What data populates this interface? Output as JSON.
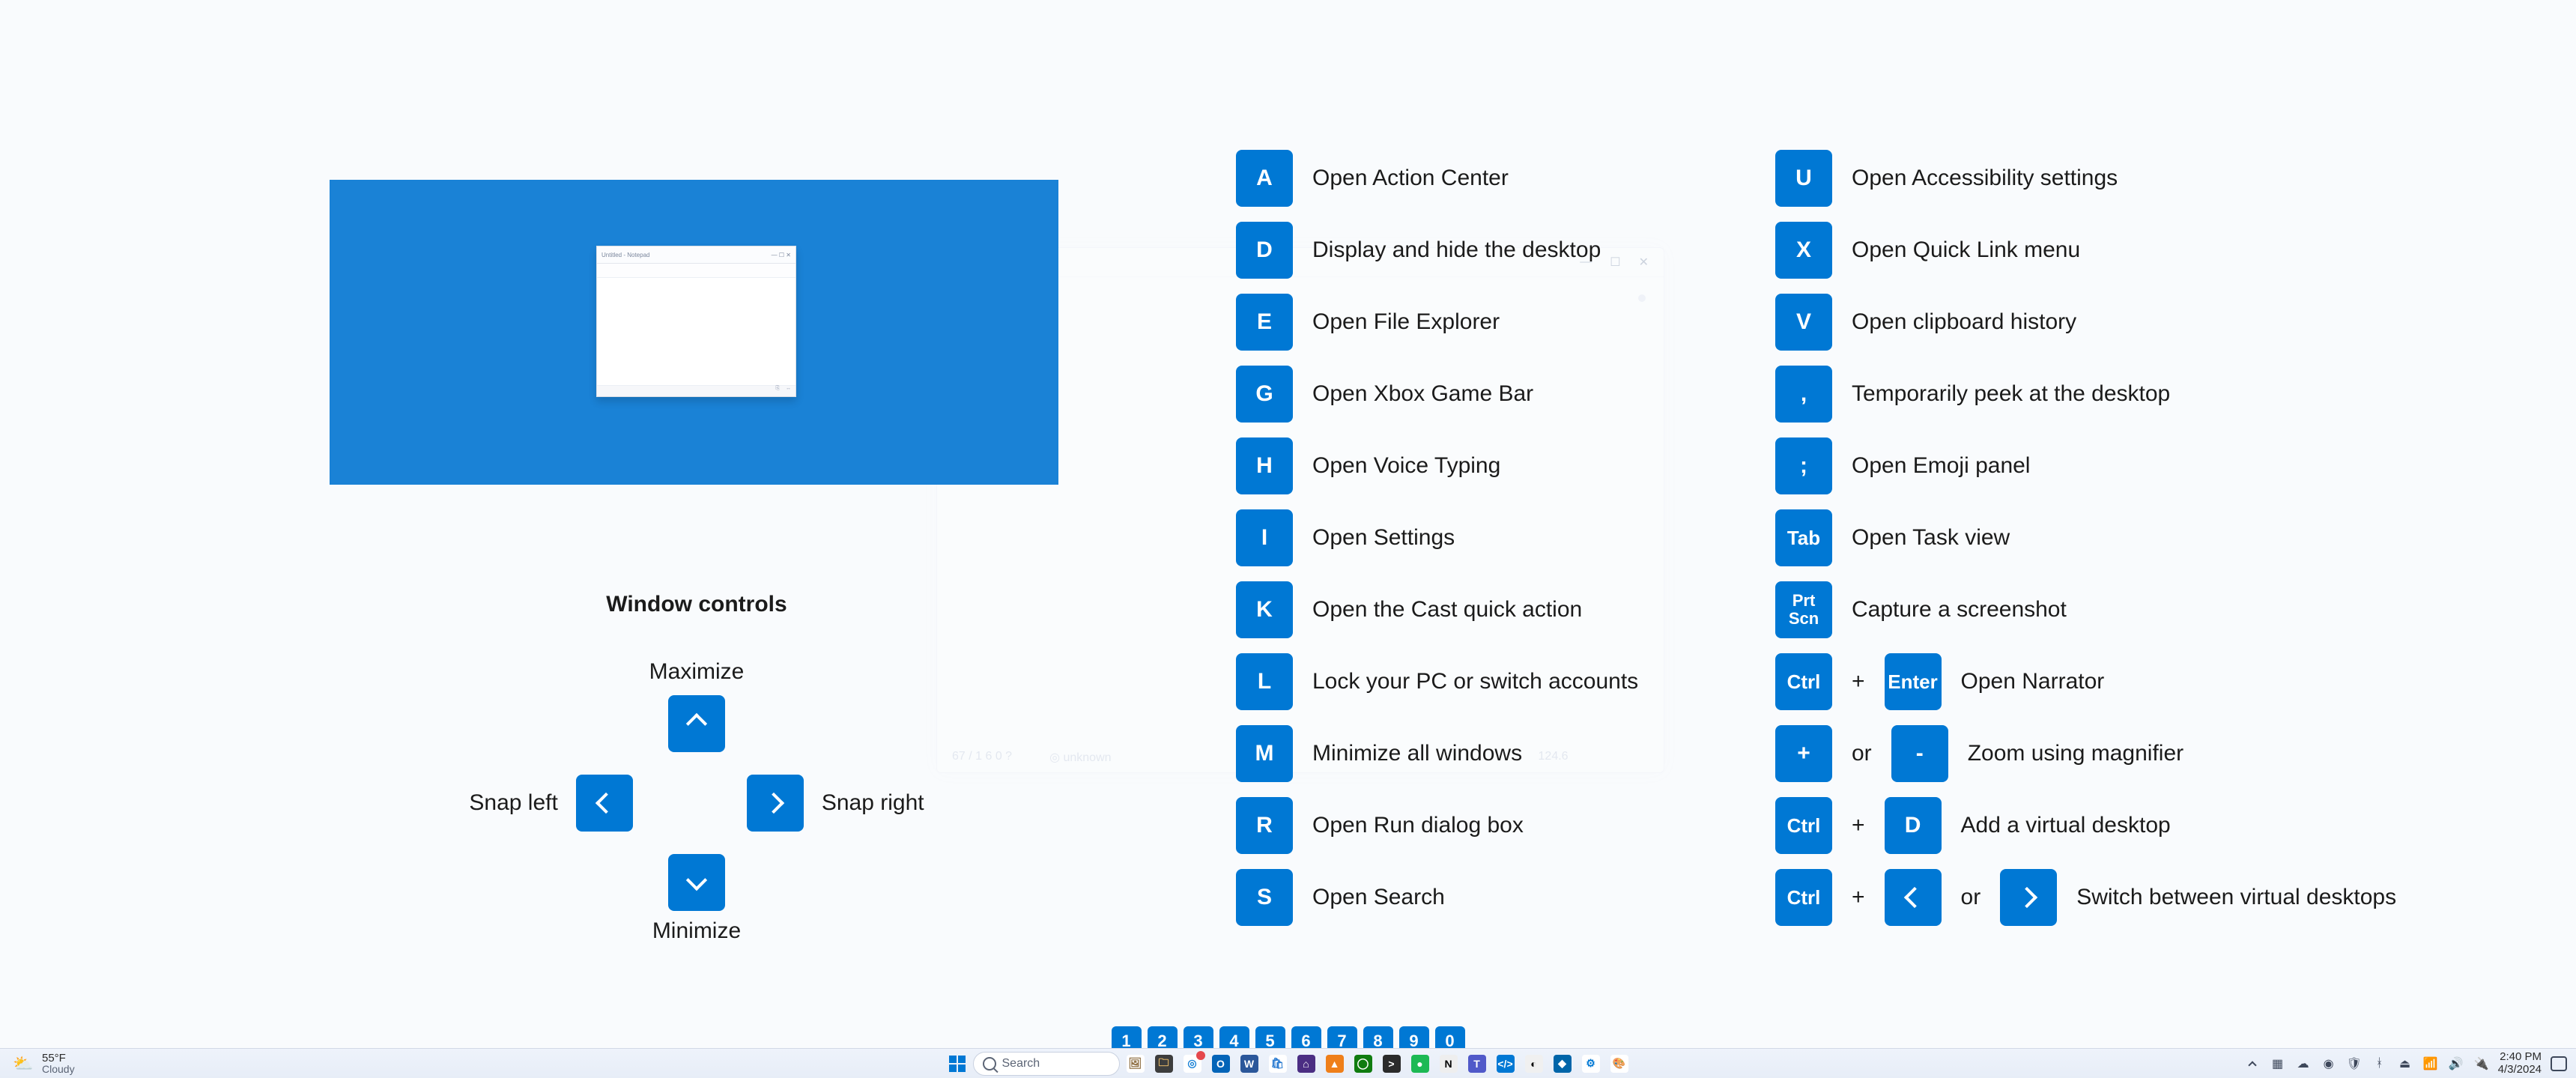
{
  "ghost_window": {
    "controls": [
      "―",
      "☐",
      "✕"
    ],
    "footer_left": "67 / 1 6 0 ?",
    "footer_mid": "◎ unknown",
    "footer_right": "124.6"
  },
  "thumbnail": {
    "mini_title_left": "Untitled - Notepad",
    "mini_title_right": "―  ☐  ✕"
  },
  "window_controls": {
    "group_title": "Window controls",
    "maximize": "Maximize",
    "minimize": "Minimize",
    "snap_left": "Snap left",
    "snap_right": "Snap right"
  },
  "shortcuts_left": [
    {
      "key": "A",
      "desc": "Open Action Center"
    },
    {
      "key": "D",
      "desc": "Display and hide the desktop"
    },
    {
      "key": "E",
      "desc": "Open File Explorer"
    },
    {
      "key": "G",
      "desc": "Open Xbox Game Bar"
    },
    {
      "key": "H",
      "desc": "Open Voice Typing"
    },
    {
      "key": "I",
      "desc": "Open Settings"
    },
    {
      "key": "K",
      "desc": "Open the Cast quick action"
    },
    {
      "key": "L",
      "desc": "Lock your PC or switch accounts"
    },
    {
      "key": "M",
      "desc": "Minimize all windows"
    },
    {
      "key": "R",
      "desc": "Open Run dialog box"
    },
    {
      "key": "S",
      "desc": "Open Search"
    }
  ],
  "shortcuts_right": [
    {
      "keys": [
        {
          "text": "U"
        }
      ],
      "desc": "Open Accessibility settings"
    },
    {
      "keys": [
        {
          "text": "X"
        }
      ],
      "desc": "Open Quick Link menu"
    },
    {
      "keys": [
        {
          "text": "V"
        }
      ],
      "desc": "Open clipboard history"
    },
    {
      "keys": [
        {
          "text": ","
        }
      ],
      "desc": "Temporarily peek at the desktop"
    },
    {
      "keys": [
        {
          "text": ";"
        }
      ],
      "desc": "Open Emoji panel"
    },
    {
      "keys": [
        {
          "text": "Tab",
          "cls": "small-txt"
        }
      ],
      "desc": "Open Task view"
    },
    {
      "keys": [
        {
          "text": "Prt\nScn",
          "cls": "multiline"
        }
      ],
      "desc": "Capture a screenshot"
    },
    {
      "keys": [
        {
          "text": "Ctrl",
          "cls": "small-txt"
        },
        {
          "joiner": "+"
        },
        {
          "text": "Enter",
          "cls": "small-txt"
        }
      ],
      "desc": "Open Narrator"
    },
    {
      "keys": [
        {
          "text": "+"
        },
        {
          "joiner": "or"
        },
        {
          "text": "-"
        }
      ],
      "desc": "Zoom using magnifier"
    },
    {
      "keys": [
        {
          "text": "Ctrl",
          "cls": "small-txt"
        },
        {
          "joiner": "+"
        },
        {
          "text": "D"
        }
      ],
      "desc": "Add a virtual desktop"
    },
    {
      "keys": [
        {
          "text": "Ctrl",
          "cls": "small-txt"
        },
        {
          "joiner": "+"
        },
        {
          "arrow": "left"
        },
        {
          "joiner": "or"
        },
        {
          "arrow": "right"
        }
      ],
      "desc": "Switch between virtual desktops"
    }
  ],
  "page_dots": [
    "1",
    "2",
    "3",
    "4",
    "5",
    "6",
    "7",
    "8",
    "9",
    "0"
  ],
  "taskbar": {
    "weather_temp": "55°F",
    "weather_desc": "Cloudy",
    "search_placeholder": "Search",
    "apps": [
      {
        "name": "picture-app",
        "bg": "#ffffff",
        "fg": "#8b6a3c",
        "glyph": "🖼"
      },
      {
        "name": "file-explorer",
        "bg": "#3d3d3d",
        "fg": "#f5c36a",
        "glyph": "🗀"
      },
      {
        "name": "edge-browser",
        "bg": "#ffffff",
        "fg": "#1a82d6",
        "glyph": "◎",
        "badge": true
      },
      {
        "name": "outlook",
        "bg": "#0364b8",
        "glyph": "O"
      },
      {
        "name": "word",
        "bg": "#2b579a",
        "glyph": "W"
      },
      {
        "name": "store",
        "bg": "#ffffff",
        "fg": "#2d7dd2",
        "glyph": "🛍"
      },
      {
        "name": "dev-home",
        "bg": "#4b2e83",
        "glyph": "⌂"
      },
      {
        "name": "vlc",
        "bg": "#ef7f1a",
        "glyph": "▲"
      },
      {
        "name": "xbox",
        "bg": "#107c10",
        "glyph": "◯"
      },
      {
        "name": "terminal",
        "bg": "#2b2b2b",
        "glyph": ">"
      },
      {
        "name": "spotify",
        "bg": "#1db954",
        "glyph": "●"
      },
      {
        "name": "notion",
        "bg": "#eeeeee",
        "fg": "#000",
        "glyph": "N"
      },
      {
        "name": "teams",
        "bg": "#5059c9",
        "glyph": "T"
      },
      {
        "name": "vscode-dev",
        "bg": "#0078d4",
        "glyph": "</>"
      },
      {
        "name": "github",
        "bg": "#f0f0f0",
        "fg": "#000",
        "glyph": "◐"
      },
      {
        "name": "vscode",
        "bg": "#0065a9",
        "glyph": "◆"
      },
      {
        "name": "settings",
        "bg": "#ffffff",
        "fg": "#0078d4",
        "glyph": "⚙"
      },
      {
        "name": "paint",
        "bg": "#ffffff",
        "fg": "#0078d4",
        "glyph": "🎨"
      }
    ],
    "tray": [
      {
        "name": "battery-icon",
        "glyph": "▦"
      },
      {
        "name": "onedrive-icon",
        "glyph": "☁"
      },
      {
        "name": "teams-tray-icon",
        "glyph": "◉"
      },
      {
        "name": "defender-icon",
        "glyph": "🛡"
      },
      {
        "name": "bluetooth-icon",
        "glyph": "ᚼ"
      },
      {
        "name": "eject-icon",
        "glyph": "⏏"
      },
      {
        "name": "wifi-icon",
        "glyph": "📶"
      },
      {
        "name": "volume-icon",
        "glyph": "🔊"
      },
      {
        "name": "power-icon",
        "glyph": "🔌"
      }
    ],
    "time": "2:40 PM",
    "date": "4/3/2024"
  }
}
